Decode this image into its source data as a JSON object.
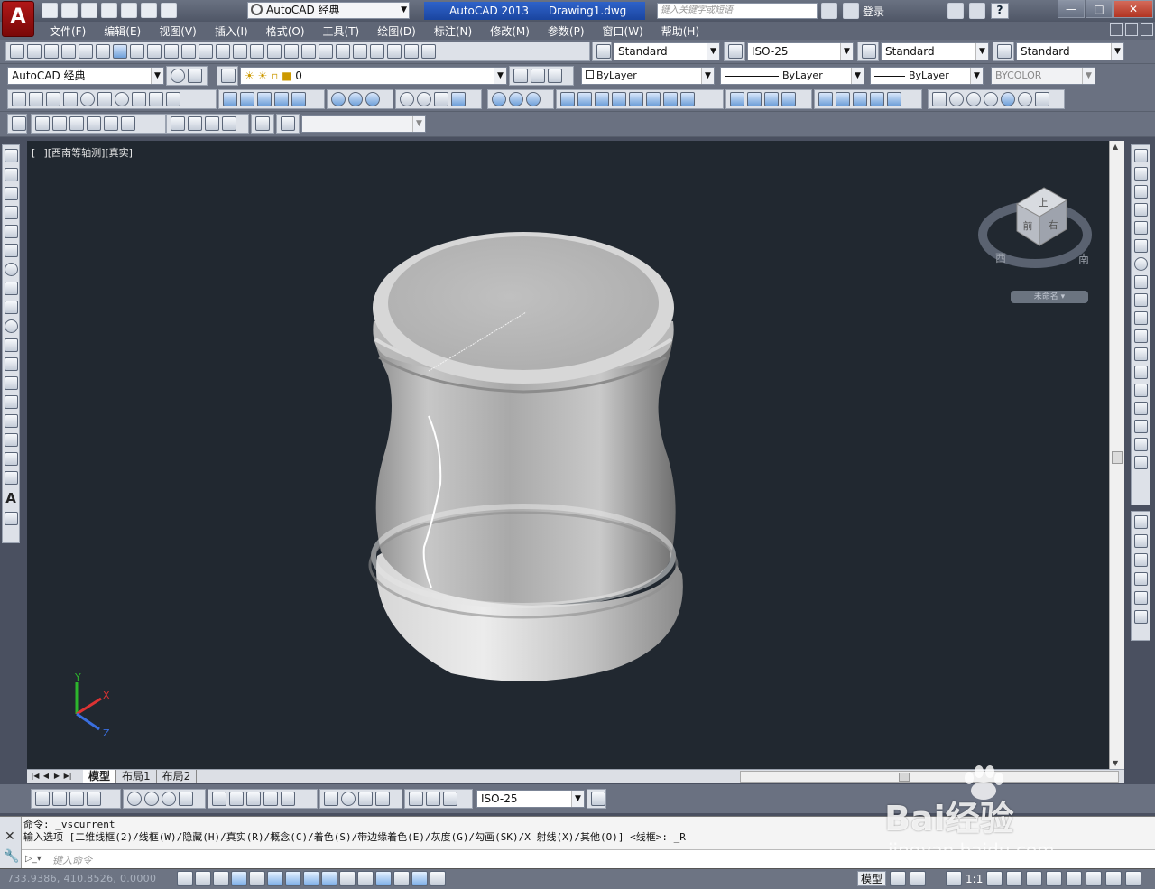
{
  "window": {
    "app_logo": "A",
    "workspace_select": "AutoCAD 经典",
    "title_app": "AutoCAD 2013",
    "title_file": "Drawing1.dwg",
    "search_placeholder": "键入关键字或短语",
    "login_label": "登录",
    "help_label": "?",
    "min_label": "—",
    "max_label": "□",
    "close_label": "✕"
  },
  "menu": {
    "items": [
      "文件(F)",
      "编辑(E)",
      "视图(V)",
      "插入(I)",
      "格式(O)",
      "工具(T)",
      "绘图(D)",
      "标注(N)",
      "修改(M)",
      "参数(P)",
      "窗口(W)",
      "帮助(H)"
    ]
  },
  "styles": {
    "text_style": "Standard",
    "dim_style": "ISO-25",
    "table_style": "Standard",
    "multileader_style": "Standard"
  },
  "layers": {
    "workspace": "AutoCAD 经典",
    "current_layer": "0",
    "color": "ByLayer",
    "linetype": "ByLayer",
    "lineweight": "ByLayer",
    "plot_style": "BYCOLOR"
  },
  "viewport": {
    "label": "[−][西南等轴测][真实]",
    "navcube_label": "未命名 ▾",
    "background": "#212830",
    "object_color": "#c8c8c8"
  },
  "layout_tabs": {
    "items": [
      "模型",
      "布局1",
      "布局2"
    ],
    "active": "模型"
  },
  "dim_toolbar": {
    "dim_style": "ISO-25"
  },
  "command": {
    "line1": "命令: _vscurrent",
    "line2": "输入选项 [二维线框(2)/线框(W)/隐藏(H)/真实(R)/概念(C)/着色(S)/带边缘着色(E)/灰度(G)/勾画(SK)/X 射线(X)/其他(O)] <线框>: _R",
    "placeholder": "键入命令"
  },
  "status": {
    "coords": "733.9386, 410.8526, 0.0000",
    "model_label": "模型",
    "scale": "1:1"
  },
  "watermark": {
    "main": "Bai经验",
    "sub": "jingyan.baidu.com"
  },
  "navcube": {
    "face_top": "上",
    "face_front": "前",
    "face_right": "右",
    "compass_west": "西",
    "compass_south": "南"
  },
  "ucs": {
    "x": "X",
    "y": "Y",
    "z": "Z"
  }
}
